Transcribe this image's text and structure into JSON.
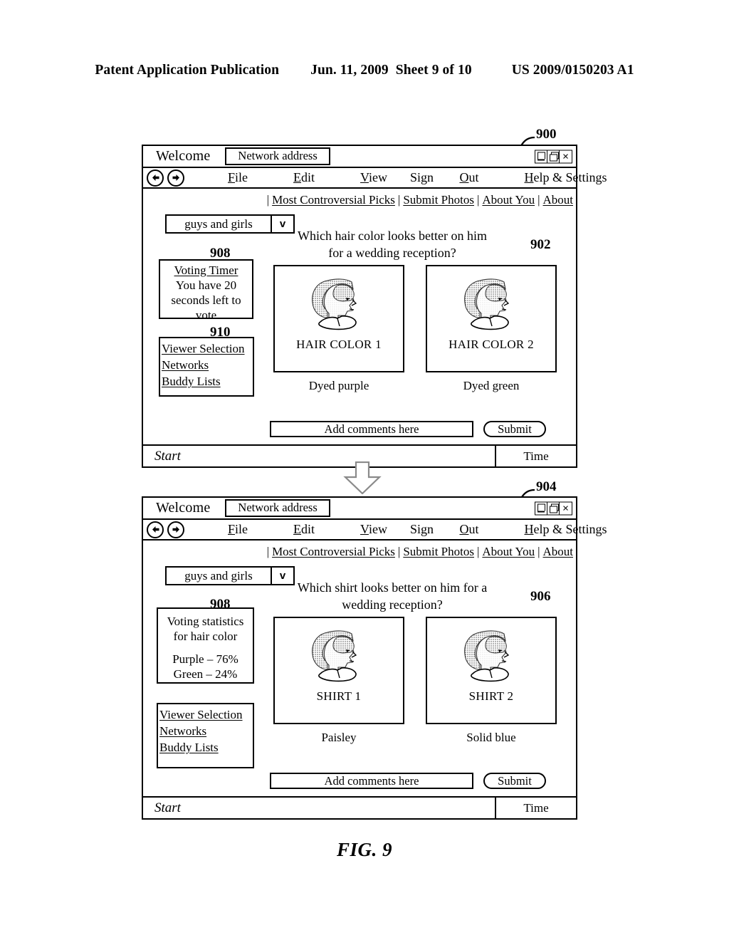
{
  "patent_header": {
    "publication": "Patent Application Publication",
    "date": "Jun. 11, 2009",
    "sheet": "Sheet 9 of 10",
    "number": "US 2009/0150203 A1"
  },
  "figure": {
    "caption": "FIG. 9"
  },
  "reference_numerals": {
    "window_top": "900",
    "question_top": "902",
    "window_bottom": "904",
    "question_bottom": "906",
    "panel_top": "908",
    "panel_viewer_top": "910",
    "panel_bottom": "908"
  },
  "window_top": {
    "titlebar": {
      "welcome": "Welcome",
      "address": "Network address",
      "controls": {
        "minimize": "minimize-icon",
        "maximize": "maximize-icon",
        "close": "×"
      }
    },
    "menubar": {
      "back": "back-arrow-icon",
      "forward": "forward-arrow-icon",
      "items": [
        {
          "pre": "",
          "accel": "F",
          "post": "ile"
        },
        {
          "pre": "",
          "accel": "E",
          "post": "dit"
        },
        {
          "pre": "",
          "accel": "V",
          "post": "iew"
        },
        {
          "pre": "Sign ",
          "accel": "O",
          "post": "ut"
        },
        {
          "pre": "",
          "accel": "H",
          "post": "elp & Settings"
        }
      ]
    },
    "links": [
      "Most Controversial Picks",
      "Submit Photos",
      "About You",
      "About"
    ],
    "link_separator": "|",
    "dropdown": {
      "value": "guys and girls",
      "arrow": "v"
    },
    "timer_panel": {
      "title": "Voting Timer",
      "line1": "You have 20",
      "line2": "seconds left to",
      "line3": "vote"
    },
    "viewer_panel": {
      "items": [
        "Viewer Selection",
        "Networks",
        "Buddy Lists"
      ]
    },
    "question": {
      "line1": "Which hair color looks better on him",
      "line2": "for a wedding reception?"
    },
    "cards": [
      {
        "label": "HAIR COLOR 1",
        "caption": "Dyed purple"
      },
      {
        "label": "HAIR COLOR 2",
        "caption": "Dyed green"
      }
    ],
    "comment_input": "Add comments here",
    "submit_button": "Submit",
    "taskbar": {
      "start": "Start",
      "time": "Time"
    }
  },
  "window_bottom": {
    "titlebar": {
      "welcome": "Welcome",
      "address": "Network address",
      "controls": {
        "minimize": "minimize-icon",
        "maximize": "maximize-icon",
        "close": "×"
      }
    },
    "menubar": {
      "back": "back-arrow-icon",
      "forward": "forward-arrow-icon",
      "items": [
        {
          "pre": "",
          "accel": "F",
          "post": "ile"
        },
        {
          "pre": "",
          "accel": "E",
          "post": "dit"
        },
        {
          "pre": "",
          "accel": "V",
          "post": "iew"
        },
        {
          "pre": "Sign ",
          "accel": "O",
          "post": "ut"
        },
        {
          "pre": "",
          "accel": "H",
          "post": "elp & Settings"
        }
      ]
    },
    "links": [
      "Most Controversial Picks",
      "Submit Photos",
      "About You",
      "About"
    ],
    "link_separator": "|",
    "dropdown": {
      "value": "guys and girls",
      "arrow": "v"
    },
    "stats_panel": {
      "title_line1": "Voting statistics",
      "title_line2": "for hair color",
      "stat1": "Purple – 76%",
      "stat2": "Green – 24%"
    },
    "viewer_panel": {
      "items": [
        "Viewer Selection",
        "Networks",
        "Buddy Lists"
      ]
    },
    "question": {
      "line1": "Which shirt looks better on him for a",
      "line2": "wedding reception?"
    },
    "cards": [
      {
        "label": "SHIRT 1",
        "caption": "Paisley"
      },
      {
        "label": "SHIRT 2",
        "caption": "Solid blue"
      }
    ],
    "comment_input": "Add comments here",
    "submit_button": "Submit",
    "taskbar": {
      "start": "Start",
      "time": "Time"
    }
  }
}
